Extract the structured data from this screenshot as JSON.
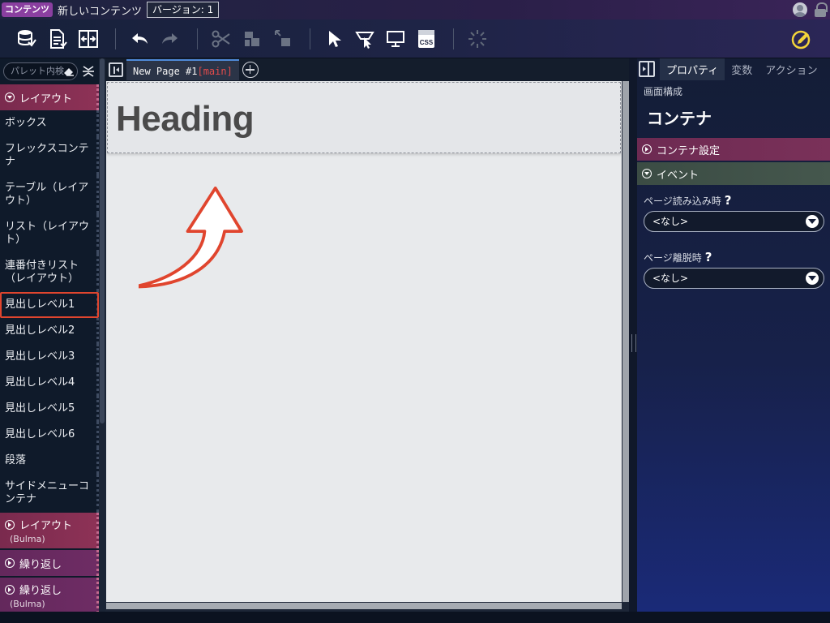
{
  "titlebar": {
    "badge": "コンテンツ",
    "content_name": "新しいコンテンツ",
    "version": "バージョン: 1"
  },
  "toolbar": {
    "buttons": [
      "database-icon",
      "document-icon",
      "split-icon",
      "undo-icon",
      "redo-icon",
      "cut-icon",
      "copy-icon",
      "paste-icon",
      "select-icon",
      "hover-icon",
      "preview-icon",
      "css-icon",
      "spinner-icon",
      "edit-mode-icon"
    ],
    "css_label": "CSS"
  },
  "palette": {
    "search_placeholder": "パレット内検",
    "categories": {
      "layout": "レイアウト",
      "layout_bulma": "レイアウト",
      "layout_bulma_sub": "(Bulma)",
      "repeat": "繰り返し",
      "repeat_bulma": "繰り返し",
      "repeat_bulma_sub": "(Bulma)"
    },
    "items": [
      "ボックス",
      "フレックスコンテナ",
      "テーブル（レイアウト）",
      "リスト（レイアウト）",
      "連番付きリスト（レイアウト）",
      "見出しレベル1",
      "見出しレベル2",
      "見出しレベル3",
      "見出しレベル4",
      "見出しレベル5",
      "見出しレベル6",
      "段落",
      "サイドメニューコンテナ"
    ]
  },
  "editor": {
    "tab_name": "New Page #1",
    "tab_tag": "[main]",
    "heading": "Heading"
  },
  "props": {
    "tabs": [
      "プロパティ",
      "変数",
      "アクション"
    ],
    "screen_structure": "画面構成",
    "title": "コンテナ",
    "section_container": "コンテナ設定",
    "section_event": "イベント",
    "field_load": "ページ読み込み時",
    "field_leave": "ページ離脱時",
    "select_value_load": "<なし>",
    "select_value_leave": "<なし>",
    "help_glyph": "?"
  },
  "colors": {
    "accent_highlight": "#e0452e",
    "layout_category": "#8d3256",
    "repeat_category": "#6e2c64",
    "event_section": "#45574d"
  }
}
